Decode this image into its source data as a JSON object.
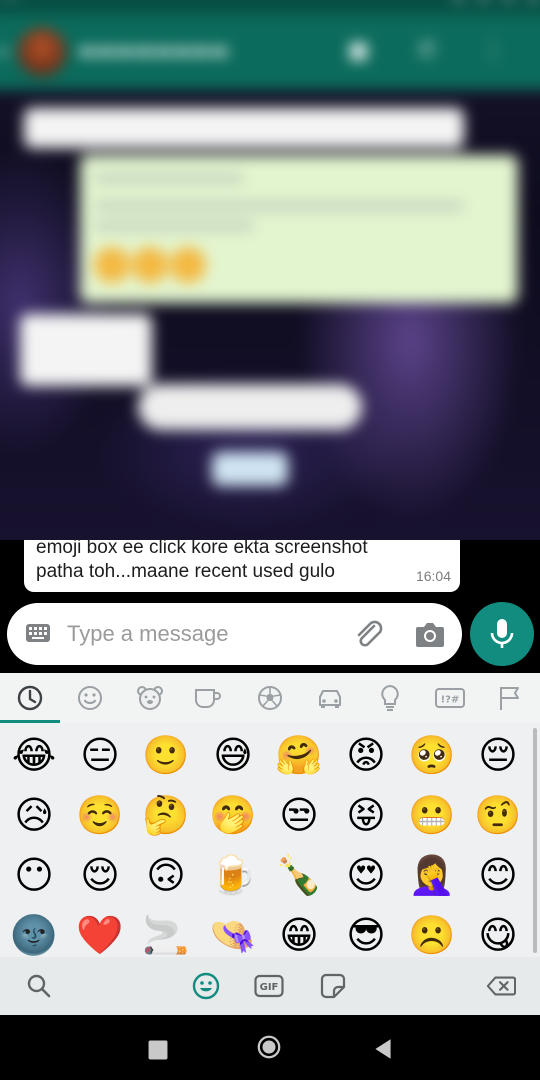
{
  "chat": {
    "message": {
      "line1": "emoji box ee click kore ekta screenshot",
      "line2": "patha toh...maane recent used gulo",
      "time": "16:04"
    }
  },
  "composer": {
    "placeholder": "Type a message"
  },
  "emoji_keyboard": {
    "categories": [
      "recent-icon",
      "smileys-icon",
      "animals-icon",
      "food-icon",
      "activity-icon",
      "travel-icon",
      "objects-icon",
      "symbols-icon",
      "flags-icon"
    ],
    "symbols_label": "!?#",
    "active_category": "recent",
    "emojis": [
      [
        "😂",
        "😑",
        "🙂",
        "😅",
        "🤗",
        "😡",
        "🥺",
        "😔"
      ],
      [
        "😥",
        "☺️",
        "🤔",
        "🤭",
        "😒",
        "😝",
        "😬",
        "🤨"
      ],
      [
        "😶",
        "😌",
        "🙃",
        "🍺",
        "🍾",
        "😍",
        "🤦‍♀️",
        "😊"
      ],
      [
        "🌚",
        "❤️",
        "🚬",
        "👒",
        "😁",
        "😎",
        "☹️",
        "😋"
      ]
    ],
    "bottom": {
      "gif_label": "GIF"
    }
  },
  "colors": {
    "accent": "#128c7e",
    "appbar": "#0b6b5c"
  }
}
